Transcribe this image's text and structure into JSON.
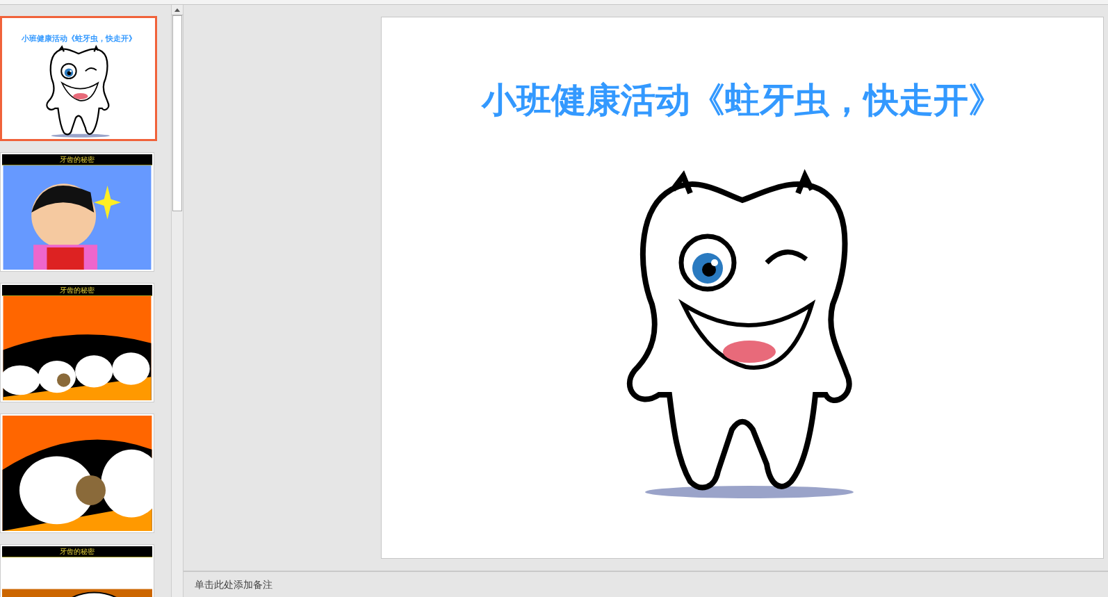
{
  "slides": [
    {
      "kind": "title",
      "title": "小班健康活动《蛀牙虫，快走开》",
      "selected": true
    },
    {
      "kind": "boy",
      "header": "牙齿的秘密",
      "selected": false
    },
    {
      "kind": "teeth",
      "header": "牙齿的秘密",
      "selected": false
    },
    {
      "kind": "closeup",
      "selected": false
    },
    {
      "kind": "bubble",
      "header": "牙齿的秘密",
      "selected": false
    }
  ],
  "current_slide": {
    "title": "小班健康活动《蛀牙虫，快走开》"
  },
  "notes": {
    "placeholder": "单击此处添加备注"
  }
}
